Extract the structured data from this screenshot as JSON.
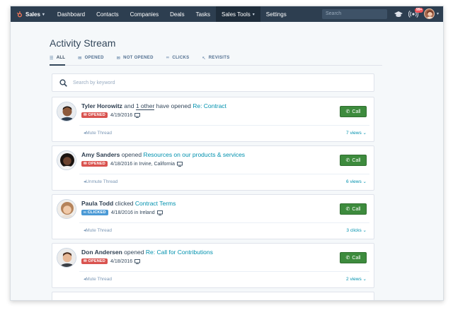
{
  "nav": {
    "brand": "Sales",
    "items": [
      "Dashboard",
      "Contacts",
      "Companies",
      "Deals",
      "Tasks",
      "Sales Tools",
      "Settings"
    ],
    "search_placeholder": "Search",
    "badge": "99+",
    "colors": {
      "bar": "#2d3e50",
      "active": "#1f2d3b",
      "brand_orange": "#ff7a59"
    }
  },
  "page": {
    "title": "Activity Stream",
    "tabs": [
      {
        "label": "ALL",
        "icon": "list-icon"
      },
      {
        "label": "OPENED",
        "icon": "envelope-open-icon"
      },
      {
        "label": "NOT OPENED",
        "icon": "envelope-icon"
      },
      {
        "label": "CLICKS",
        "icon": "link-icon"
      },
      {
        "label": "REVISITS",
        "icon": "pointer-icon"
      }
    ],
    "search_placeholder": "Search by keyword"
  },
  "activities": [
    {
      "name": "Tyler Horowitz",
      "connector": " and ",
      "other": "1 other",
      "action": " have opened ",
      "subject": "Re: Contract",
      "status": "OPENED",
      "date": "4/19/2016",
      "call": "Call",
      "thread_action": "Mute Thread",
      "count": "7 views"
    },
    {
      "name": "Amy Sanders",
      "action": " opened ",
      "subject": "Resources on our products & services",
      "status": "OPENED",
      "date": "4/18/2016 in Irvine, California",
      "call": "Call",
      "thread_action": "Unmute Thread",
      "count": "6 views"
    },
    {
      "name": "Paula Todd",
      "action": " clicked ",
      "subject": "Contract Terms",
      "status": "CLICKED",
      "date": "4/18/2016 in Ireland",
      "call": "Call",
      "thread_action": "Mute Thread",
      "count": "3 clicks"
    },
    {
      "name": "Don Andersen",
      "action": " opened ",
      "subject": "Re: Call for Contributions",
      "status": "OPENED",
      "date": "4/18/2016",
      "call": "Call",
      "thread_action": "Mute Thread",
      "count": "2 views"
    }
  ],
  "colors": {
    "call_button": "#3d8b3d",
    "opened_pill": "#d9534f",
    "clicked_pill": "#4b9ad6",
    "link": "#0091ae"
  }
}
